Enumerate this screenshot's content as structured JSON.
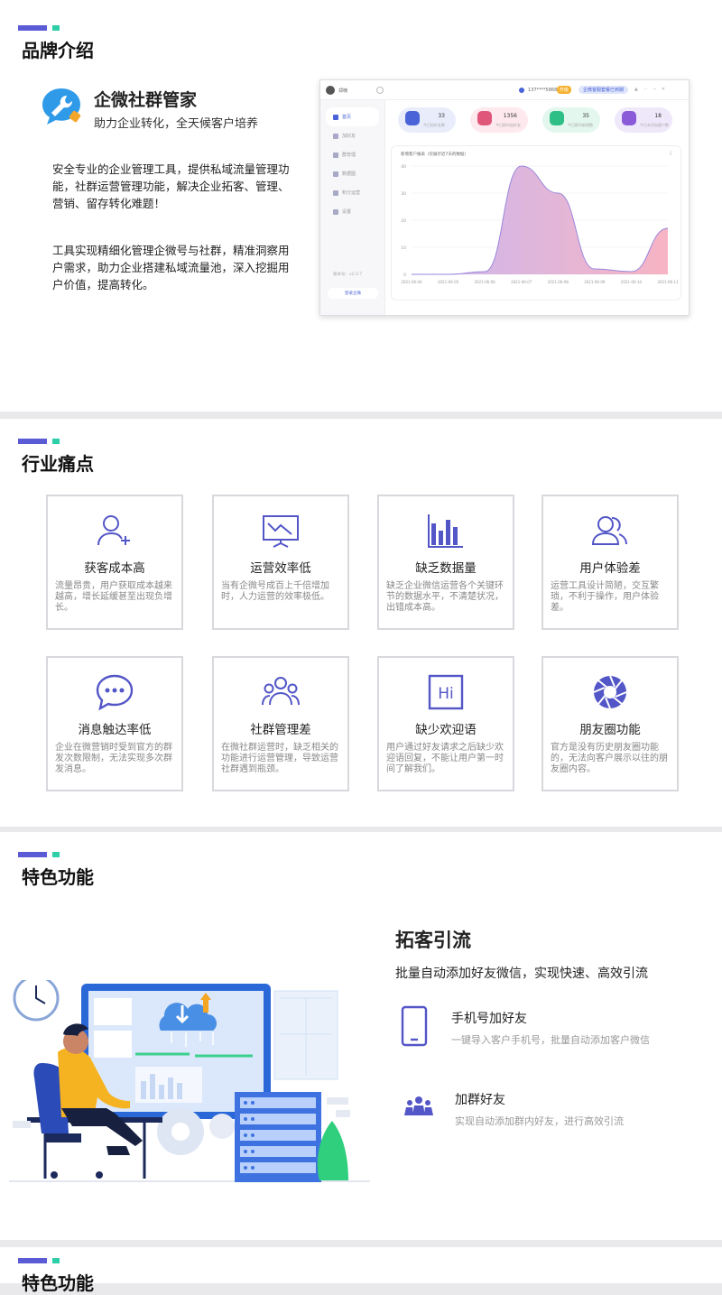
{
  "brand": {
    "section_title": "品牌介绍",
    "name": "企微社群管家",
    "subtitle": "助力企业转化，全天候客户培养",
    "para1": "安全专业的企业管理工具，提供私域流量管理功能，社群运营管理功能，解决企业拓客、管理、营销、留存转化难题！",
    "para2": "工具实现精细化管理企微号与社群，精准洞察用户需求，助力企业搭建私域流量池，深入挖掘用户价值，提高转化。",
    "mock": {
      "user": "郑楠",
      "phone": "137****5868",
      "vip_badge": "升级",
      "top_button": "企微客服套餐已到期",
      "sidebar": [
        "首页",
        "加好友",
        "群管理",
        "数据图",
        "积分运营",
        "设置"
      ],
      "version_label": "版本号：v2.0.7",
      "logout": "登录企微",
      "stats": [
        {
          "value": "33",
          "label": "今日加好友数",
          "color": "#4a64d8",
          "bg": "#e9edfb"
        },
        {
          "value": "1356",
          "label": "今日群内加好友",
          "color": "#e0567a",
          "bg": "#fde9ee"
        },
        {
          "value": "35",
          "label": "今日群内新增数",
          "color": "#2ebf86",
          "bg": "#e3f7ee"
        },
        {
          "value": "18",
          "label": "今日未添加客户数",
          "color": "#8a5ad9",
          "bg": "#efe8fb"
        }
      ]
    },
    "chart_data": {
      "type": "area",
      "title": "新增客户报表（仅展示近7天的数据）",
      "x": [
        "2021-06-04",
        "2021-06-05",
        "2021-06-06",
        "2021-06-07",
        "2021-06-08",
        "2021-06-09",
        "2021-06-10",
        "2021-06-11"
      ],
      "values": [
        0,
        0,
        1,
        40,
        30,
        2,
        1,
        17
      ],
      "yticks": [
        0,
        10,
        20,
        30,
        40
      ],
      "ylim": [
        0,
        40
      ],
      "grid": true
    }
  },
  "pain": {
    "section_title": "行业痛点",
    "cards": [
      {
        "icon": "user-add-icon",
        "title": "获客成本高",
        "desc": "流量昂贵，用户获取成本越来越高，增长延缓甚至出现负增长。"
      },
      {
        "icon": "presentation-chart-icon",
        "title": "运营效率低",
        "desc": "当有企微号成百上千倍增加时，人力运营的效率极低。"
      },
      {
        "icon": "bar-chart-icon",
        "title": "缺乏数据量",
        "desc": "缺乏企业微信运营各个关键环节的数据水平，不清楚状况，出错成本高。"
      },
      {
        "icon": "users-icon",
        "title": "用户体验差",
        "desc": "运营工具设计简陋，交互繁琐，不利于操作，用户体验差。"
      },
      {
        "icon": "chat-bubble-icon",
        "title": "消息触达率低",
        "desc": "企业在微营销时受到官方的群发次数限制，无法实现多次群发消息。"
      },
      {
        "icon": "group-icon",
        "title": "社群管理差",
        "desc": "在微社群运营时，缺乏相关的功能进行运营管理，导致运营社群遇到瓶颈。"
      },
      {
        "icon": "hi-icon",
        "title": "缺少欢迎语",
        "desc": "用户通过好友请求之后缺少欢迎语回复，不能让用户第一时间了解我们。"
      },
      {
        "icon": "aperture-icon",
        "title": "朋友圈功能",
        "desc": "官方是没有历史朋友圈功能的，无法向客户展示以往的朋友圈内容。"
      }
    ]
  },
  "feature": {
    "section_title": "特色功能",
    "heading": "拓客引流",
    "subtitle": "批量自动添加好友微信，实现快速、高效引流",
    "items": [
      {
        "icon": "phone-icon",
        "title": "手机号加好友",
        "desc": "一键导入客户手机号，批量自动添加客户微信"
      },
      {
        "icon": "people-group-icon",
        "title": "加群好友",
        "desc": "实现自动添加群内好友，进行高效引流"
      }
    ]
  },
  "next": {
    "section_title": "特色功能"
  },
  "colors": {
    "accent": "#5b5bd6",
    "accent2": "#2ecfa8",
    "icon": "#5356c7"
  }
}
